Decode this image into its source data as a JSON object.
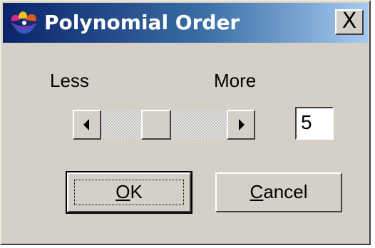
{
  "window": {
    "title": "Polynomial Order",
    "close_glyph": "X",
    "icon": "app-icon"
  },
  "slider": {
    "min_label": "Less",
    "max_label": "More",
    "left_arrow_icon": "arrow-left-icon",
    "right_arrow_icon": "arrow-right-icon",
    "value": "5"
  },
  "buttons": {
    "ok": {
      "access_key": "O",
      "rest": "K"
    },
    "cancel": {
      "access_key": "C",
      "rest": "ancel"
    }
  },
  "colors": {
    "title_bar_start": "#0a246a",
    "title_bar_end": "#a6caf0",
    "dialog_face": "#d4d0c8"
  }
}
